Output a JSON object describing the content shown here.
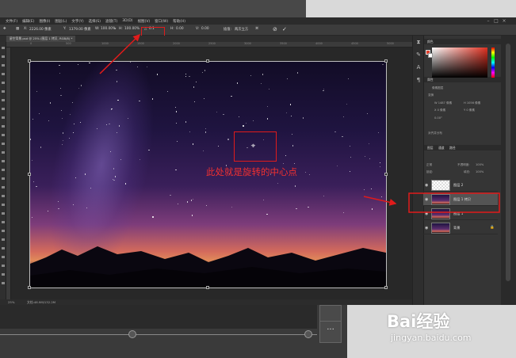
{
  "menubar": {
    "items": [
      "文件(F)",
      "编辑(E)",
      "图像(I)",
      "图层(L)",
      "文字(Y)",
      "选择(S)",
      "滤镜(T)",
      "3D(D)",
      "视图(V)",
      "窗口(W)",
      "帮助(H)"
    ]
  },
  "optionsbar": {
    "x_label": "X:",
    "x_value": "2226.00 像素",
    "y_label": "Y:",
    "y_value": "1379.00 像素",
    "w_label": "W:",
    "w_value": "100.00%",
    "h_label": "H:",
    "h_value": "100.00%",
    "angle_label": "△",
    "angle_value": "0.1",
    "hskew_label": "H:",
    "hskew_value": "0.00",
    "vskew_label": "V:",
    "vskew_value": "0.00",
    "interp_label": "插值:",
    "interp_value": "两次立方"
  },
  "document": {
    "tab_title": "星空背景.psd @ 25% (图层 1 拷贝, RGB/8) *"
  },
  "ruler": {
    "marks": [
      "0",
      "500",
      "1000",
      "1500",
      "2000",
      "2500",
      "3000",
      "3500",
      "4000",
      "4500",
      "5000"
    ]
  },
  "annotation": {
    "text": "此处就是旋转的中心点"
  },
  "statusbar": {
    "zoom": "25%",
    "doc_info": "文档:46.9M/132.2M"
  },
  "panels": {
    "color_tab": "颜色",
    "properties_tab": "属性",
    "properties_sub": "像素图层",
    "transform_label": "变换",
    "align_label": "对齐并分布",
    "layers_tab": "图层",
    "channels_tab": "通道",
    "paths_tab": "路径",
    "blend_mode": "正常",
    "opacity_label": "不透明度:",
    "opacity_value": "100%",
    "lock_label": "锁定:",
    "fill_label": "填充:",
    "fill_value": "100%",
    "prop_w": "W 1487 像素",
    "prop_h": "H 1056 像素",
    "prop_x": "X 0 像素",
    "prop_y": "Y 0 像素",
    "prop_angle": "0.00°"
  },
  "layers": [
    {
      "name": "图层 2",
      "selected": false,
      "thumb": "transparent"
    },
    {
      "name": "图层 1 拷贝",
      "selected": true,
      "thumb": "sky"
    },
    {
      "name": "图层 1",
      "selected": false,
      "thumb": "sky"
    },
    {
      "name": "背景",
      "selected": false,
      "thumb": "sky",
      "locked": true
    }
  ],
  "watermark": {
    "brand": "Bai经验",
    "url": "jingyan.baidu.com"
  },
  "colors": {
    "annotation_red": "#e01b1b",
    "foreground": "#e0402e",
    "background": "#ffffff"
  }
}
